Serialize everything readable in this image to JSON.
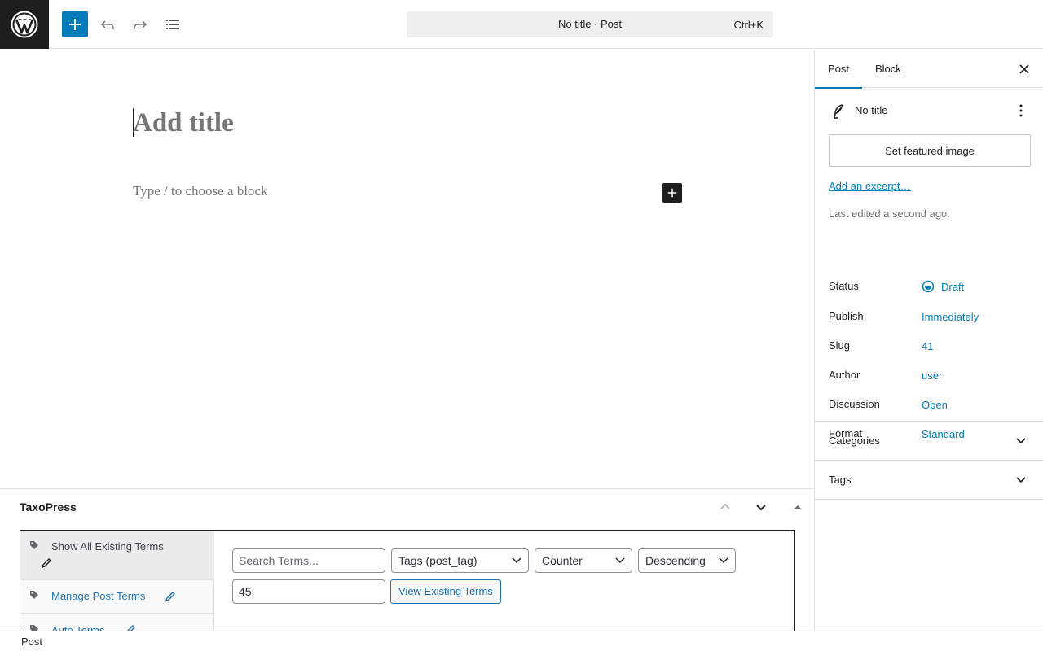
{
  "toolbar": {
    "logo_icon": "wordpress-logo-icon",
    "inserter_icon": "plus-icon",
    "undo_icon": "undo-icon",
    "redo_icon": "redo-icon",
    "document_overview_icon": "list-view-icon"
  },
  "command_bar": {
    "title": "No title · Post",
    "shortcut": "Ctrl+K"
  },
  "editor": {
    "title_placeholder": "Add title",
    "block_placeholder": "Type / to choose a block",
    "add_block_icon": "plus-icon"
  },
  "metabox": {
    "title": "TaxoPress",
    "controls": [
      "chevron-up-icon",
      "chevron-down-icon",
      "triangle-up-icon"
    ],
    "nav": [
      {
        "label": "Show All Existing Terms",
        "icon": "tag-icon",
        "edit_icon": "pencil-icon",
        "active": true
      },
      {
        "label": "Manage Post Terms",
        "icon": "tag-icon",
        "edit_icon": "pencil-icon",
        "active": false
      },
      {
        "label": "Auto Terms",
        "icon": "tag-icon",
        "edit_icon": "pencil-icon",
        "active": false
      }
    ],
    "search_placeholder": "Search Terms...",
    "taxonomy_select": "Tags (post_tag)",
    "orderby_select": "Counter",
    "order_select": "Descending",
    "limit_value": "45",
    "view_button": "View Existing Terms"
  },
  "sidebar": {
    "tabs": [
      {
        "label": "Post",
        "active": true
      },
      {
        "label": "Block",
        "active": false
      }
    ],
    "close_icon": "close-icon",
    "post_title": "No title",
    "post_icon": "feather-icon",
    "more_icon": "more-vertical-icon",
    "featured_image_button": "Set featured image",
    "excerpt_link": "Add an excerpt…",
    "last_edited": "Last edited a second ago.",
    "meta": [
      {
        "key": "Status",
        "value": "Draft",
        "icon": "draft-status-icon"
      },
      {
        "key": "Publish",
        "value": "Immediately"
      },
      {
        "key": "Slug",
        "value": "41"
      },
      {
        "key": "Author",
        "value": "user"
      },
      {
        "key": "Discussion",
        "value": "Open"
      },
      {
        "key": "Format",
        "value": "Standard"
      }
    ],
    "panels": [
      {
        "label": "Categories",
        "icon": "chevron-down-icon"
      },
      {
        "label": "Tags",
        "icon": "chevron-down-icon"
      }
    ]
  },
  "footer": {
    "breadcrumb": "Post"
  },
  "colors": {
    "accent": "#007cba",
    "link": "#2271b1",
    "dark": "#1e1e1e",
    "border": "#e0e0e0"
  }
}
